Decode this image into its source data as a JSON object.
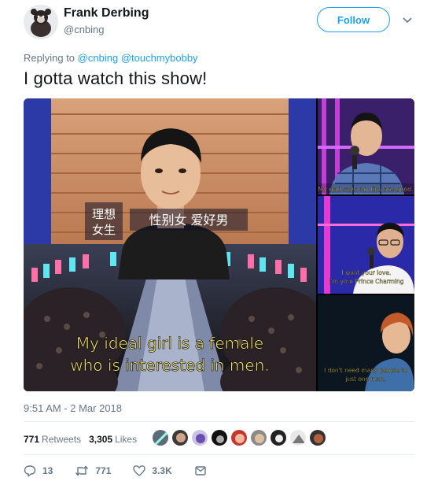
{
  "author": {
    "name": "Frank Derbing",
    "handle": "@cnbing",
    "follow_label": "Follow"
  },
  "reply": {
    "prefix": "Replying to",
    "mentions": [
      "@cnbing",
      "@touchmybobby"
    ]
  },
  "tweet": {
    "text": "I gotta watch this show!",
    "timestamp": "9:51 AM - 2 Mar 2018"
  },
  "media": {
    "main": {
      "caption_cn_1": "理想",
      "caption_cn_2": "女生",
      "caption_cn_3": "性别女 爱好男",
      "subtitle_line1": "My ideal girl is a female",
      "subtitle_line2": "who is interested in men."
    },
    "side": [
      {
        "subtitle": "My dad says my lips are good."
      },
      {
        "subtitle_line1": "I want your love.",
        "subtitle_line2": "I'm your Prince Charming"
      },
      {
        "subtitle_line1": "I don't need many people to",
        "subtitle_line2": "just one man."
      }
    ]
  },
  "stats": {
    "retweets_count": "771",
    "retweets_label": "Retweets",
    "likes_count": "3,305",
    "likes_label": "Likes"
  },
  "actions": {
    "replies": "13",
    "retweets": "771",
    "likes": "3.3K"
  },
  "colors": {
    "accent": "#1da1f2",
    "secondary_text": "#657786",
    "subtitle_yellow": "#f5e26a"
  }
}
